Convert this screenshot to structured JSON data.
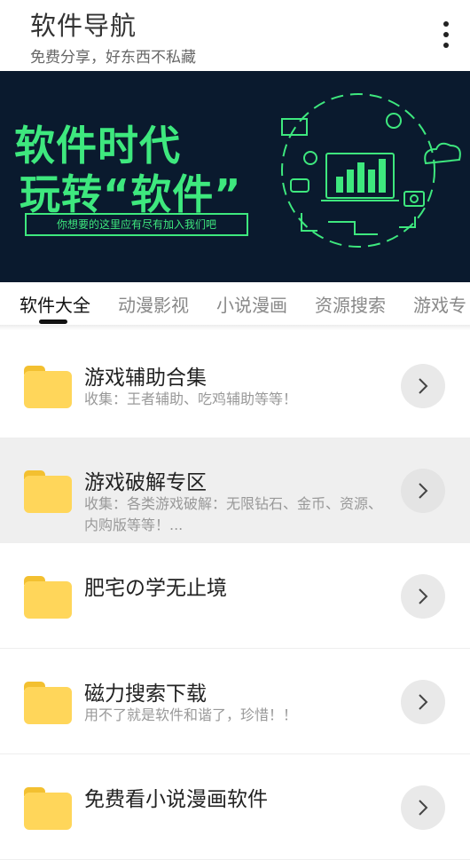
{
  "header": {
    "title": "软件导航",
    "subtitle": "免费分享，好东西不私藏"
  },
  "banner": {
    "line1": "软件时代",
    "line2": "玩转“软件”",
    "tagline": "你想要的这里应有尽有加入我们吧",
    "accent_color": "#3ee87e",
    "background_color": "#0a1a2e"
  },
  "tabs": [
    {
      "label": "软件大全",
      "active": true
    },
    {
      "label": "动漫影视",
      "active": false
    },
    {
      "label": "小说漫画",
      "active": false
    },
    {
      "label": "资源搜索",
      "active": false
    },
    {
      "label": "游戏专",
      "active": false
    }
  ],
  "list": [
    {
      "title": "游戏辅助合集",
      "desc": "收集：王者辅助、吃鸡辅助等等！",
      "icon": "folder-icon"
    },
    {
      "title": "游戏破解专区",
      "desc": "收集：各类游戏破解：无限钻石、金币、资源、内购版等等！...",
      "icon": "folder-icon"
    },
    {
      "title": "肥宅の学无止境",
      "desc": "",
      "icon": "folder-icon"
    },
    {
      "title": "磁力搜索下载",
      "desc": "用不了就是软件和谐了，珍惜！！",
      "icon": "folder-icon"
    },
    {
      "title": "免费看小说漫画软件",
      "desc": "",
      "icon": "folder-icon"
    }
  ]
}
